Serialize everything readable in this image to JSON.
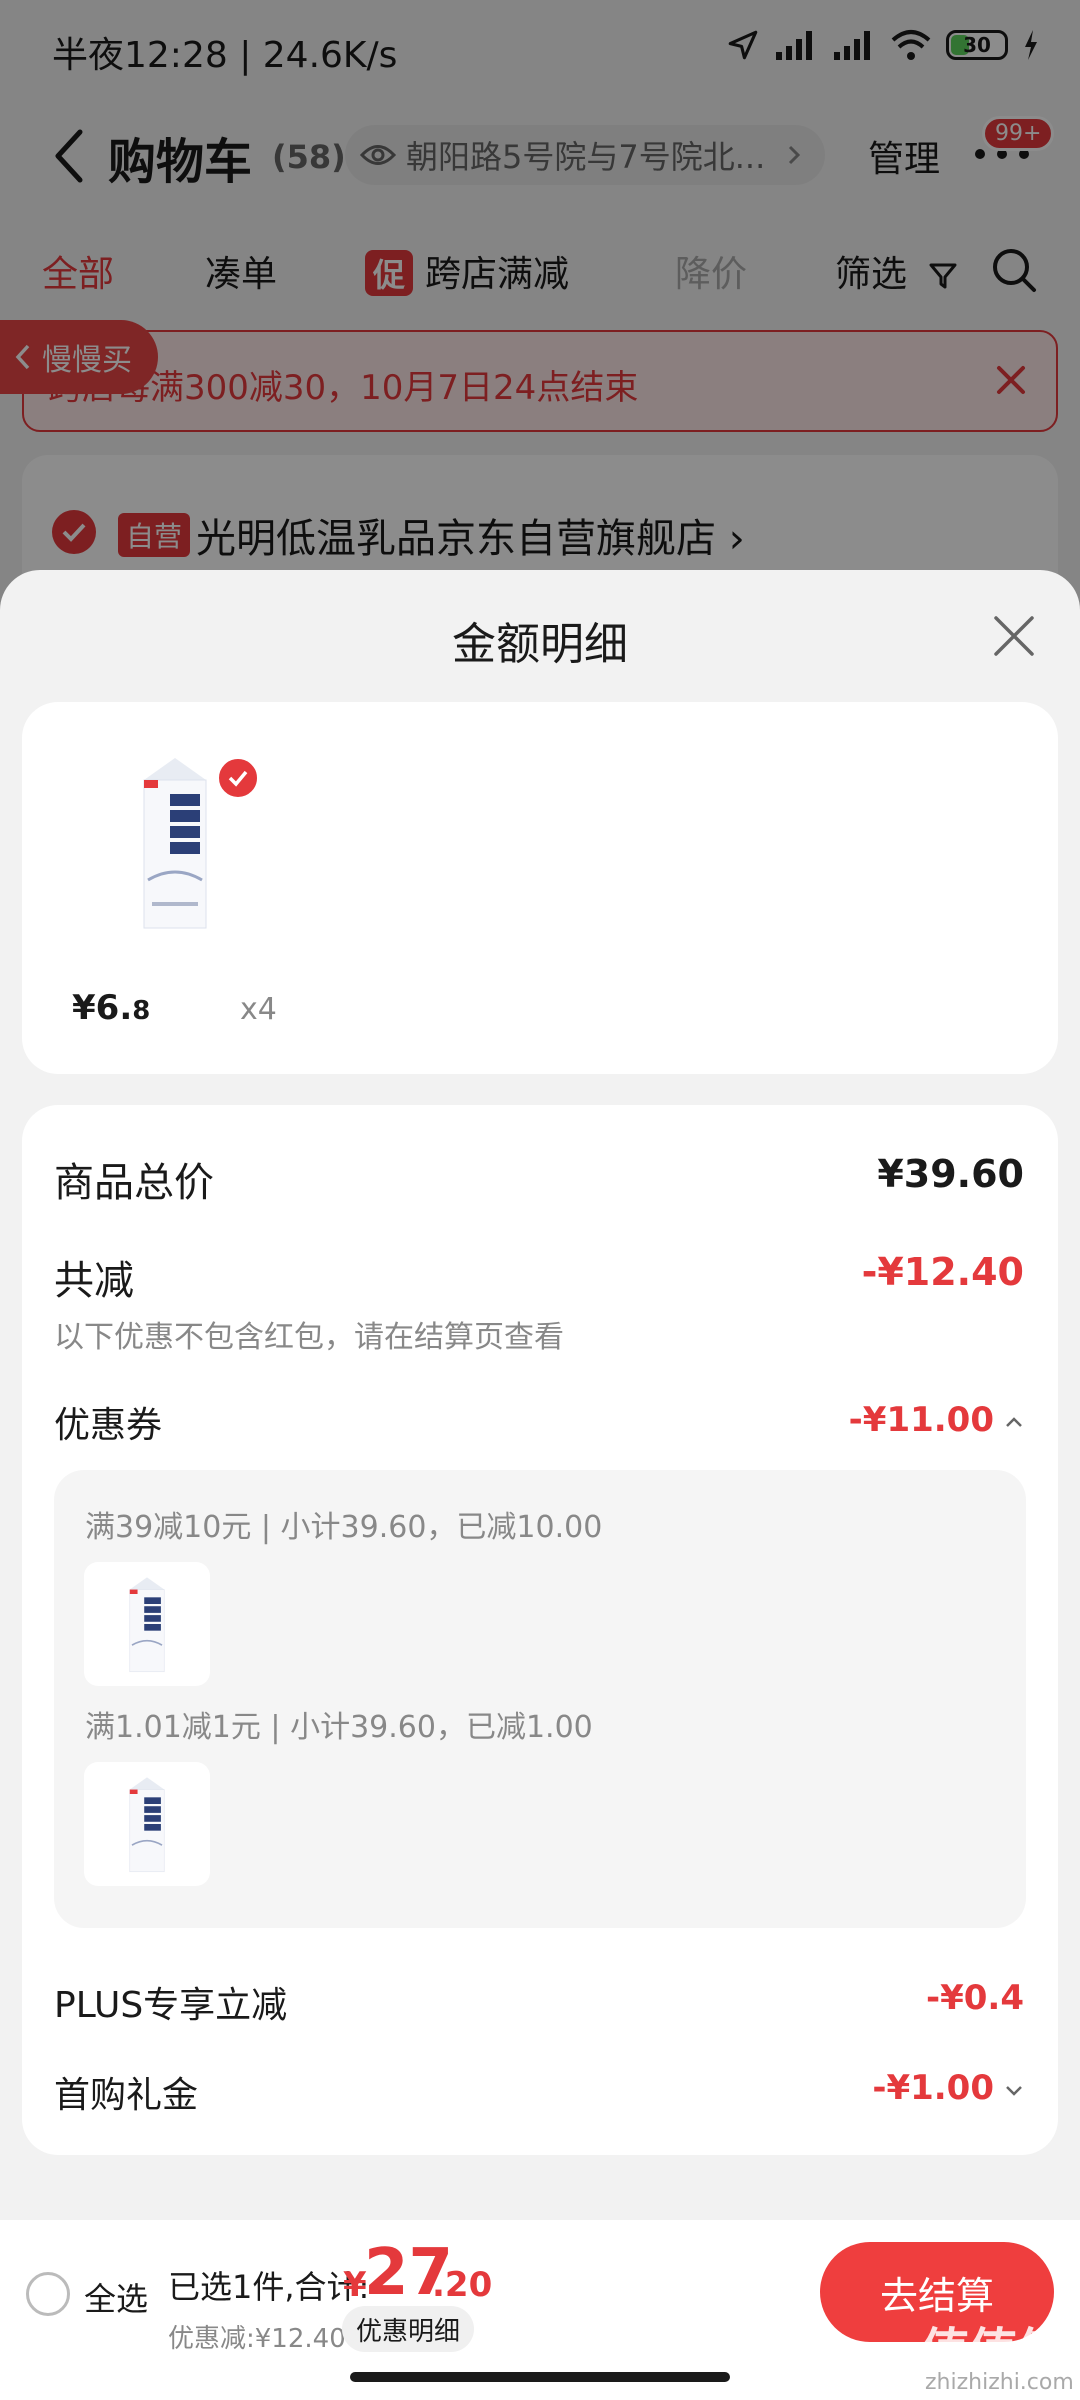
{
  "status_bar": {
    "time_speed": "半夜12:28 | 24.6K/s",
    "battery": "30"
  },
  "header": {
    "title": "购物车",
    "count": "(58)",
    "address": "朝阳路5号院与7号院北...",
    "manage": "管理",
    "badge": "99+"
  },
  "tabs": {
    "all": "全部",
    "combine": "凑单",
    "promo_tag": "促",
    "cross_store": "跨店满减",
    "price_drop": "降价",
    "filter": "筛选"
  },
  "notice": {
    "text": "跨店每满300减30，10月7日24点结束",
    "slow_buy": "慢慢买"
  },
  "store": {
    "tag": "自营",
    "name": "光明低温乳品京东自营旗舰店 ›"
  },
  "sheet": {
    "title": "金额明细",
    "product": {
      "price_int": "¥6.",
      "price_dec": "8",
      "qty": "x4"
    },
    "goods_total_label": "商品总价",
    "goods_total_value": "¥39.60",
    "total_off_label": "共减",
    "total_off_value": "-¥12.40",
    "note": "以下优惠不包含红包，请在结算页查看",
    "coupon_label": "优惠券",
    "coupon_value": "-¥11.00",
    "coupon_rule_1": "满39减10元 | 小计39.60，已减10.00",
    "coupon_rule_2": "满1.01减1元 | 小计39.60，已减1.00",
    "plus_label": "PLUS专享立减",
    "plus_value": "-¥0.4",
    "gift_label": "首购礼金",
    "gift_value": "-¥1.00"
  },
  "bottom": {
    "select_all": "全选",
    "selected": "已选1件,合计:",
    "yen": "¥",
    "total_int": "27",
    "total_dec": ".20",
    "discount": "优惠减:¥12.40",
    "detail_chip": "优惠明细",
    "checkout": "去结算"
  },
  "watermark": {
    "main": "值值值",
    "sub": "zhizhizhi.com"
  },
  "colors": {
    "accent": "#e4393c",
    "checkout": "#ef3e3e",
    "sheet_bg": "#f2f2f2"
  }
}
